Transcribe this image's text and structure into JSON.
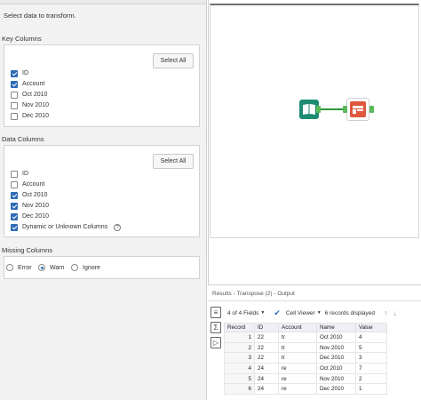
{
  "config": {
    "instruction": "Select data to transform.",
    "key_columns": {
      "title": "Key Columns",
      "select_all": "Select All",
      "items": [
        {
          "label": "ID",
          "checked": true
        },
        {
          "label": "Account",
          "checked": true
        },
        {
          "label": "Oct 2010",
          "checked": false
        },
        {
          "label": "Nov 2010",
          "checked": false
        },
        {
          "label": "Dec 2010",
          "checked": false
        }
      ]
    },
    "data_columns": {
      "title": "Data Columns",
      "select_all": "Select All",
      "items": [
        {
          "label": "ID",
          "checked": false
        },
        {
          "label": "Account",
          "checked": false
        },
        {
          "label": "Oct 2010",
          "checked": true
        },
        {
          "label": "Nov 2010",
          "checked": true
        },
        {
          "label": "Dec 2010",
          "checked": true
        },
        {
          "label": "Dynamic or Unknown Columns",
          "checked": true
        }
      ],
      "help_glyph": "?"
    },
    "missing_columns": {
      "title": "Missing Columns",
      "options": [
        {
          "label": "Error",
          "selected": false
        },
        {
          "label": "Warn",
          "selected": true
        },
        {
          "label": "Ignore",
          "selected": false
        }
      ]
    }
  },
  "canvas": {
    "tools": [
      {
        "name": "input-data-tool",
        "icon": "book-icon",
        "color": "#1e8b73"
      },
      {
        "name": "transpose-tool",
        "icon": "transpose-icon",
        "color": "#e0573c"
      }
    ],
    "connector_color": "#2a9a3a"
  },
  "results": {
    "title": "Results - Transpose (2) - Output",
    "fields_label": "4 of 4 Fields",
    "viewer_label": "Cell Viewer",
    "records_label": "6 records displayed",
    "columns": [
      "Record",
      "ID",
      "Account",
      "Name",
      "Value"
    ],
    "rows": [
      [
        "1",
        "22",
        "tr",
        "Oct 2010",
        "4"
      ],
      [
        "2",
        "22",
        "tr",
        "Nov 2010",
        "5"
      ],
      [
        "3",
        "22",
        "tr",
        "Dec 2010",
        "3"
      ],
      [
        "4",
        "24",
        "re",
        "Oct 2010",
        "7"
      ],
      [
        "5",
        "24",
        "re",
        "Nov 2010",
        "2"
      ],
      [
        "6",
        "24",
        "re",
        "Dec 2010",
        "1"
      ]
    ]
  },
  "colors": {
    "accent": "#2f6bb3",
    "header_bg": "#eef0f5"
  }
}
